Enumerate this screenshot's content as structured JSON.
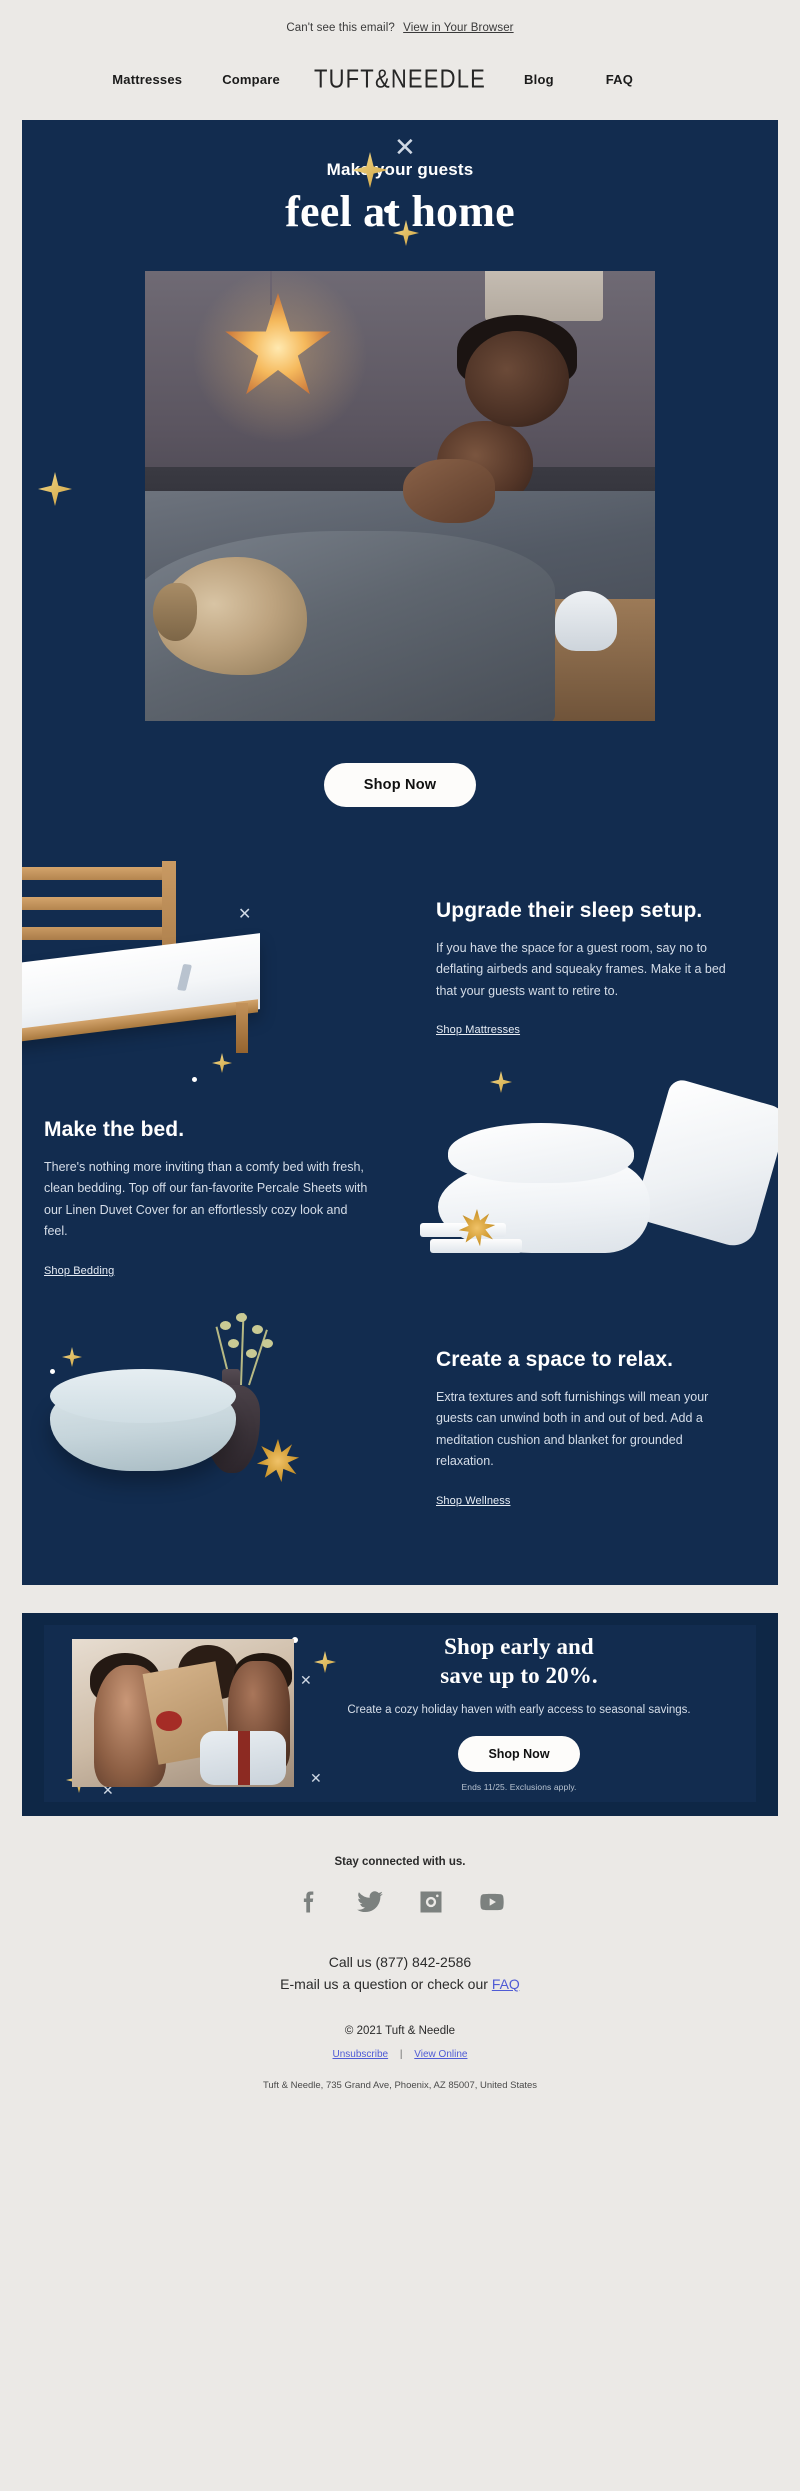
{
  "preheader": {
    "text": "Can't see this email?",
    "link": "View in Your Browser"
  },
  "nav": {
    "left": [
      {
        "label": "Mattresses"
      },
      {
        "label": "Compare"
      }
    ],
    "logo": "TUFT&NEEDLE",
    "right": [
      {
        "label": "Blog"
      },
      {
        "label": "FAQ"
      }
    ]
  },
  "hero": {
    "kicker": "Make your guests",
    "title": "feel at home",
    "cta": "Shop Now",
    "image_alt": "Couple and dog sleeping in bed with star lamp"
  },
  "features": [
    {
      "heading": "Upgrade their sleep setup.",
      "body": "If you have the space for a guest room, say no to deflating airbeds and squeaky frames. Make it a bed that your guests want to retire to.",
      "link": "Shop Mattresses",
      "image_alt": "Wooden bed frame with white mattress"
    },
    {
      "heading": "Make the bed.",
      "body": "There's nothing more inviting than a comfy bed with fresh, clean bedding. Top off our fan-favorite Percale Sheets with our Linen Duvet Cover for an effortlessly cozy look and feel.",
      "link": "Shop Bedding",
      "image_alt": "Folded white duvet, pillows and sheet set"
    },
    {
      "heading": "Create a space to relax.",
      "body": "Extra textures and soft furnishings will mean your guests can unwind both in and out of bed. Add a meditation cushion and blanket for grounded relaxation.",
      "link": "Shop Wellness",
      "image_alt": "Light blue meditation cushion with vase and dried stems"
    }
  ],
  "promo": {
    "heading_line1": "Shop early and",
    "heading_line2": "save up to 20%.",
    "body": "Create a cozy holiday haven with early access to seasonal savings.",
    "cta": "Shop Now",
    "fine_print": "Ends 11/25. Exclusions apply.",
    "image_alt": "Family opening a Tuft & Needle gift box"
  },
  "footer": {
    "stay_connected": "Stay connected with us.",
    "socials": [
      {
        "name": "facebook-icon"
      },
      {
        "name": "twitter-icon"
      },
      {
        "name": "instagram-icon"
      },
      {
        "name": "youtube-icon"
      }
    ],
    "call": "Call us (877) 842-2586",
    "email_prefix": "E-mail us a question or check our",
    "email_link": "FAQ",
    "copyright": "© 2021 Tuft & Needle",
    "unsubscribe": "Unsubscribe",
    "divider": "|",
    "view_online": "View Online",
    "address": "Tuft & Needle, 735 Grand Ave, Phoenix, AZ 85007, United States"
  },
  "colors": {
    "page_bg": "#ebe9e6",
    "panel_navy": "#122c4f",
    "gold": "#d9ae57",
    "button_bg": "#fdfcfa",
    "link_blue": "#4f5bd5"
  }
}
